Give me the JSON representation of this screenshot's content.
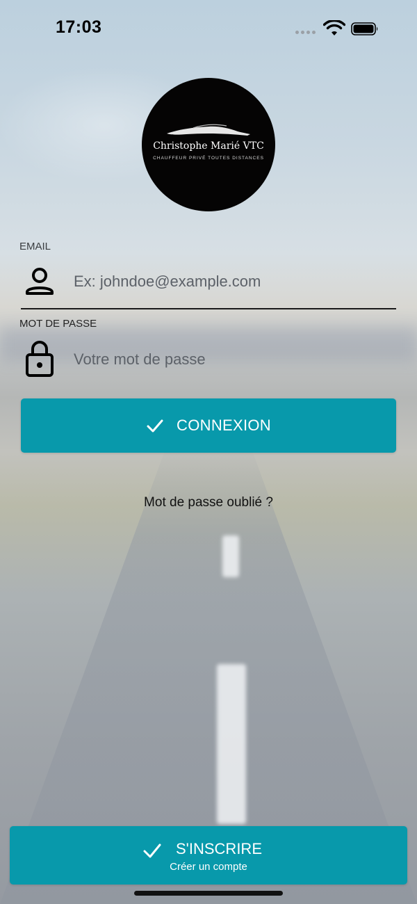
{
  "status_bar": {
    "time": "17:03"
  },
  "logo": {
    "name": "Christophe Marié VTC",
    "tagline": "CHAUFFEUR PRIVÉ TOUTES DISTANCES"
  },
  "form": {
    "email": {
      "label": "EMAIL",
      "placeholder": "Ex: johndoe@example.com",
      "value": "",
      "icon": "user-icon"
    },
    "password": {
      "label": "MOT DE PASSE",
      "placeholder": "Votre mot de passe",
      "value": "",
      "icon": "lock-icon"
    }
  },
  "actions": {
    "login_label": "CONNEXION",
    "forgot_label": "Mot de passe oublié ?",
    "signup_label": "S'INSCRIRE",
    "signup_sublabel": "Créer un compte"
  },
  "colors": {
    "accent": "#0899ab",
    "logo_bg": "#050404"
  }
}
